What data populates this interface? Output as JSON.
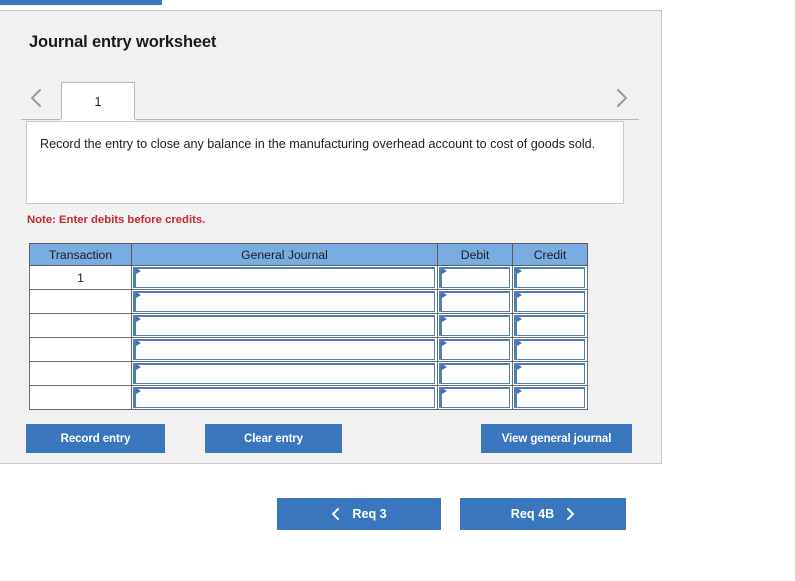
{
  "progress_bar": {
    "accent_color": "#3a76bd"
  },
  "panel": {
    "title": "Journal entry worksheet"
  },
  "tabs": {
    "prev_icon": "chevron-left-icon",
    "next_icon": "chevron-right-icon",
    "items": [
      {
        "label": "1",
        "active": true
      }
    ]
  },
  "instruction": {
    "text": "Record the entry to close any balance in the manufacturing overhead account to cost of goods sold."
  },
  "note": {
    "text": "Note: Enter debits before credits.",
    "color": "#c3282d"
  },
  "table": {
    "headers": [
      "Transaction",
      "General Journal",
      "Debit",
      "Credit"
    ],
    "header_color": "#79ace1",
    "rows": [
      {
        "transaction": "1",
        "general_journal": "",
        "debit": "",
        "credit": ""
      },
      {
        "transaction": "",
        "general_journal": "",
        "debit": "",
        "credit": ""
      },
      {
        "transaction": "",
        "general_journal": "",
        "debit": "",
        "credit": ""
      },
      {
        "transaction": "",
        "general_journal": "",
        "debit": "",
        "credit": ""
      },
      {
        "transaction": "",
        "general_journal": "",
        "debit": "",
        "credit": ""
      },
      {
        "transaction": "",
        "general_journal": "",
        "debit": "",
        "credit": ""
      }
    ]
  },
  "actions": {
    "record_label": "Record entry",
    "clear_label": "Clear entry",
    "view_label": "View general journal",
    "button_color": "#3a76bd"
  },
  "pagination": {
    "prev_label": "Req 3",
    "next_label": "Req 4B",
    "prev_icon": "chevron-left-icon",
    "next_icon": "chevron-right-icon"
  }
}
